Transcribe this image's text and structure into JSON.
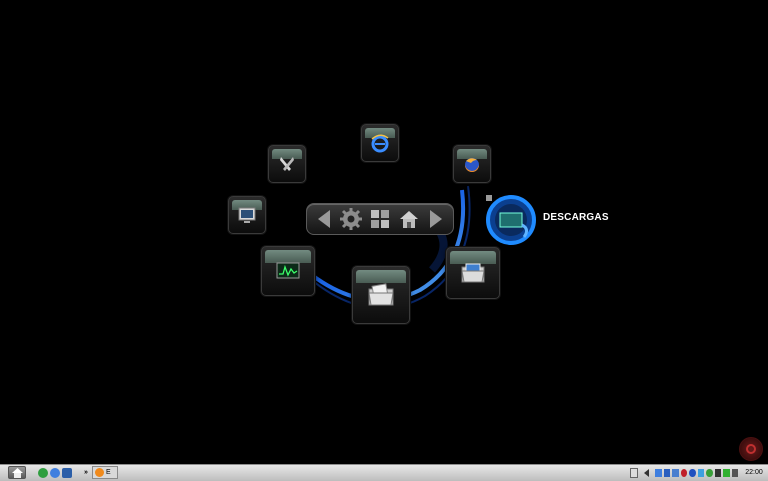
{
  "launcher": {
    "selected_label": "DESCARGAS",
    "items": [
      {
        "name": "internet-explorer",
        "icon": "internet-explorer-icon"
      },
      {
        "name": "firefox",
        "icon": "firefox-icon"
      },
      {
        "name": "tools",
        "icon": "tools-icon"
      },
      {
        "name": "my-computer",
        "icon": "computer-icon"
      },
      {
        "name": "system-monitor",
        "icon": "monitor-graph-icon"
      },
      {
        "name": "documents",
        "icon": "document-folder-icon"
      },
      {
        "name": "pictures",
        "icon": "picture-folder-icon"
      },
      {
        "name": "downloads",
        "icon": "downloads-icon"
      }
    ],
    "nav": [
      "back-arrow-icon",
      "settings-gear-icon",
      "windows-grid-icon",
      "home-icon",
      "forward-arrow-icon"
    ]
  },
  "taskbar": {
    "task_firefox_label": "E",
    "ql_more": "»",
    "clock": "22:00",
    "tray_icons": [
      "keyboard-icon",
      "arrow-left-icon",
      "network-icon",
      "calendar-icon",
      "display-icon",
      "antivirus-icon",
      "bluetooth-icon",
      "messenger-icon",
      "monitor-icon",
      "green-icon",
      "volume-icon"
    ]
  },
  "colors": {
    "accent_blue": "#1e7bff",
    "tile_header": "#6f8c80",
    "background": "#000000"
  }
}
